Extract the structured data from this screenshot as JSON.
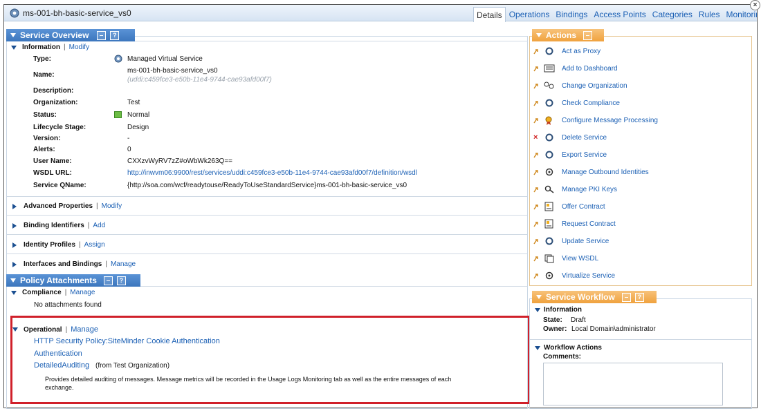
{
  "window": {
    "title": "ms-001-bh-basic-service_vs0",
    "close_label": "×"
  },
  "tabs": [
    "Details",
    "Operations",
    "Bindings",
    "Access Points",
    "Categories",
    "Rules",
    "Monitoring"
  ],
  "service_overview": {
    "title": "Service Overview",
    "information": {
      "label": "Information",
      "modify": "Modify"
    },
    "fields": {
      "type_label": "Type:",
      "type_value": "Managed Virtual Service",
      "name_label": "Name:",
      "name_value": "ms-001-bh-basic-service_vs0",
      "name_uddi": "(uddi:c459fce3-e50b-11e4-9744-cae93afd00f7)",
      "description_label": "Description:",
      "organization_label": "Organization:",
      "organization_value": "Test",
      "status_label": "Status:",
      "status_value": "Normal",
      "lifecycle_label": "Lifecycle Stage:",
      "lifecycle_value": "Design",
      "version_label": "Version:",
      "version_value": "-",
      "alerts_label": "Alerts:",
      "alerts_value": "0",
      "username_label": "User Name:",
      "username_value": "CXXzvWyRV7zZ#oWbWk263Q==",
      "wsdl_label": "WSDL URL:",
      "wsdl_value": "http://inwvm06:9900/rest/services/uddi:c459fce3-e50b-11e4-9744-cae93afd00f7/definition/wsdl",
      "qname_label": "Service QName:",
      "qname_value": "{http://soa.com/wcf/readytouse/ReadyToUseStandardService}ms-001-bh-basic-service_vs0"
    },
    "advanced": {
      "label": "Advanced Properties",
      "link": "Modify"
    },
    "binding_ids": {
      "label": "Binding Identifiers",
      "link": "Add"
    },
    "identity": {
      "label": "Identity Profiles",
      "link": "Assign"
    },
    "interfaces": {
      "label": "Interfaces and Bindings",
      "link": "Manage"
    }
  },
  "policy_attachments": {
    "title": "Policy Attachments",
    "compliance": {
      "label": "Compliance",
      "link": "Manage",
      "empty": "No attachments found"
    },
    "operational": {
      "label": "Operational",
      "link": "Manage",
      "items": [
        "HTTP Security Policy:SiteMinder Cookie Authentication",
        "Authentication",
        "DetailedAuditing"
      ],
      "from_org": "(from Test Organization)",
      "description_line1": "Provides detailed auditing of messages. Message metrics will be recorded in the Usage Logs Monitoring tab as well as the entire messages of each",
      "description_line2": "exchange."
    }
  },
  "actions": {
    "title": "Actions",
    "items": [
      {
        "label": "Act as Proxy",
        "icon": "gear-icon"
      },
      {
        "label": "Add to Dashboard",
        "icon": "dashboard-icon"
      },
      {
        "label": "Change Organization",
        "icon": "organization-icon"
      },
      {
        "label": "Check Compliance",
        "icon": "gear-icon"
      },
      {
        "label": "Configure Message Processing",
        "icon": "ribbon-icon"
      },
      {
        "label": "Delete Service",
        "icon": "delete-icon"
      },
      {
        "label": "Export Service",
        "icon": "gear-icon"
      },
      {
        "label": "Manage Outbound Identities",
        "icon": "identity-icon"
      },
      {
        "label": "Manage PKI Keys",
        "icon": "key-icon"
      },
      {
        "label": "Offer Contract",
        "icon": "contract-icon"
      },
      {
        "label": "Request Contract",
        "icon": "contract-icon"
      },
      {
        "label": "Update Service",
        "icon": "gear-icon"
      },
      {
        "label": "View WSDL",
        "icon": "wsdl-icon"
      },
      {
        "label": "Virtualize Service",
        "icon": "virtualize-icon"
      }
    ]
  },
  "workflow": {
    "title": "Service Workflow",
    "information_label": "Information",
    "state_label": "State:",
    "state_value": "Draft",
    "owner_label": "Owner:",
    "owner_value": "Local Domain\\administrator",
    "actions_label": "Workflow Actions",
    "comments_label": "Comments:"
  },
  "colors": {
    "accent": "#3c76bd",
    "actions_header": "#f0a23e",
    "highlight": "#d0202a",
    "link": "#1a5fb4"
  }
}
